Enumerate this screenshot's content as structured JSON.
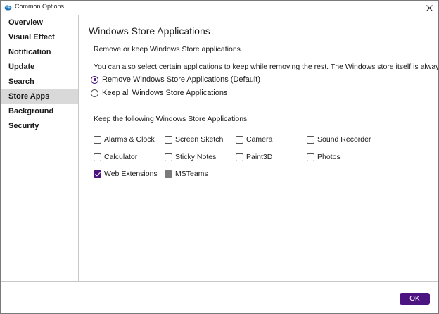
{
  "window": {
    "title": "Common Options",
    "close_symbol": "✕"
  },
  "sidebar": {
    "items": [
      {
        "label": "Overview",
        "selected": false
      },
      {
        "label": "Visual Effect",
        "selected": false
      },
      {
        "label": "Notification",
        "selected": false
      },
      {
        "label": "Update",
        "selected": false
      },
      {
        "label": "Search",
        "selected": false
      },
      {
        "label": "Store Apps",
        "selected": true
      },
      {
        "label": "Background",
        "selected": false
      },
      {
        "label": "Security",
        "selected": false
      }
    ]
  },
  "main": {
    "title": "Windows Store Applications",
    "description1": "Remove or keep Windows Store applications.",
    "description2": "You can also select certain applications to keep while removing the rest. The Windows store itself is always kept.",
    "options": [
      {
        "label": "Remove Windows Store Applications (Default)",
        "checked": true
      },
      {
        "label": "Keep all Windows Store Applications",
        "checked": false
      }
    ],
    "keep_heading": "Keep the following Windows Store Applications",
    "apps": [
      {
        "label": "Alarms & Clock",
        "checked": false,
        "enabled": true
      },
      {
        "label": "Screen Sketch",
        "checked": false,
        "enabled": true
      },
      {
        "label": "Camera",
        "checked": false,
        "enabled": true
      },
      {
        "label": "Sound Recorder",
        "checked": false,
        "enabled": true
      },
      {
        "label": "Calculator",
        "checked": false,
        "enabled": true
      },
      {
        "label": "Sticky Notes",
        "checked": false,
        "enabled": true
      },
      {
        "label": "Paint3D",
        "checked": false,
        "enabled": true
      },
      {
        "label": "Photos",
        "checked": false,
        "enabled": true
      },
      {
        "label": "Web Extensions",
        "checked": true,
        "enabled": true
      },
      {
        "label": "MSTeams",
        "checked": false,
        "enabled": false
      }
    ]
  },
  "footer": {
    "ok_label": "OK"
  },
  "colors": {
    "accent": "#4b1480",
    "selected_nav_bg": "#d9d9d9",
    "disabled_checkbox": "#7a7a7a"
  },
  "icons": {
    "app_icon": "cloud-logo-icon",
    "close_icon": "close-icon"
  }
}
